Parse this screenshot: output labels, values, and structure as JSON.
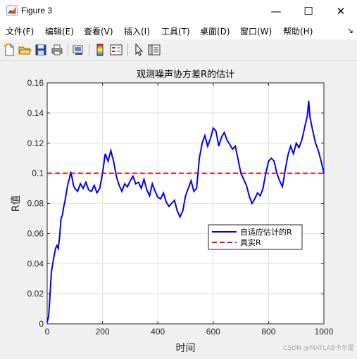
{
  "window": {
    "title": "Figure 3",
    "minimize": "—",
    "maximize": "☐",
    "close": "✕"
  },
  "menu": {
    "items": [
      "文件(F)",
      "编辑(E)",
      "查看(V)",
      "插入(I)",
      "工具(T)",
      "桌面(D)",
      "窗口(W)",
      "帮助(H)"
    ],
    "overflow": "↘"
  },
  "toolbar": {
    "icons": [
      "new-figure-icon",
      "open-file-icon",
      "save-icon",
      "print-icon",
      "link-plot-icon",
      "colorbar-icon",
      "legend-icon",
      "pointer-icon",
      "property-editor-icon"
    ]
  },
  "watermark": "CSDN @MATLAB卡尔曼",
  "colors": {
    "estimate": "#0000ff",
    "truth": "#ff0000",
    "grid": "#dfdfdf"
  },
  "chart_data": {
    "type": "line",
    "title": "观测噪声协方差R的估计",
    "xlabel": "时间",
    "ylabel": "R值",
    "xlim": [
      0,
      1000
    ],
    "ylim": [
      0,
      0.16
    ],
    "xticks": [
      0,
      200,
      400,
      600,
      800,
      1000
    ],
    "yticks": [
      0,
      0.02,
      0.04,
      0.06,
      0.08,
      0.1,
      0.12,
      0.14,
      0.16
    ],
    "xtick_labels": [
      "0",
      "200",
      "400",
      "600",
      "800",
      "1000"
    ],
    "ytick_labels": [
      "0",
      "0.02",
      "0.04",
      "0.06",
      "0.08",
      "0.1",
      "0.12",
      "0.14",
      "0.16"
    ],
    "grid": true,
    "legend_position": "lower-right",
    "series": [
      {
        "name": "自适应估计的R",
        "style": "solid",
        "x": [
          0,
          5,
          10,
          15,
          20,
          25,
          30,
          35,
          40,
          45,
          50,
          55,
          60,
          65,
          70,
          75,
          80,
          85,
          90,
          95,
          100,
          110,
          120,
          130,
          140,
          150,
          160,
          170,
          180,
          190,
          200,
          210,
          220,
          230,
          240,
          250,
          260,
          270,
          280,
          290,
          300,
          310,
          320,
          330,
          340,
          350,
          360,
          370,
          380,
          390,
          400,
          410,
          420,
          430,
          440,
          450,
          460,
          470,
          480,
          490,
          500,
          510,
          520,
          530,
          540,
          550,
          560,
          570,
          580,
          590,
          600,
          610,
          620,
          630,
          640,
          650,
          660,
          670,
          680,
          690,
          700,
          710,
          720,
          730,
          740,
          750,
          760,
          770,
          780,
          790,
          800,
          810,
          820,
          830,
          840,
          850,
          860,
          870,
          880,
          890,
          900,
          910,
          920,
          930,
          940,
          945,
          950,
          960,
          970,
          980,
          990,
          1000
        ],
        "y": [
          0.001,
          0.005,
          0.018,
          0.034,
          0.04,
          0.045,
          0.05,
          0.052,
          0.05,
          0.058,
          0.07,
          0.072,
          0.078,
          0.082,
          0.088,
          0.093,
          0.096,
          0.101,
          0.097,
          0.092,
          0.09,
          0.088,
          0.093,
          0.09,
          0.094,
          0.089,
          0.088,
          0.092,
          0.087,
          0.09,
          0.1,
          0.113,
          0.108,
          0.115,
          0.108,
          0.098,
          0.092,
          0.088,
          0.093,
          0.091,
          0.095,
          0.098,
          0.093,
          0.094,
          0.09,
          0.096,
          0.089,
          0.085,
          0.093,
          0.088,
          0.084,
          0.083,
          0.087,
          0.081,
          0.078,
          0.08,
          0.082,
          0.075,
          0.071,
          0.075,
          0.085,
          0.09,
          0.095,
          0.088,
          0.09,
          0.11,
          0.12,
          0.125,
          0.118,
          0.123,
          0.13,
          0.128,
          0.118,
          0.124,
          0.127,
          0.122,
          0.119,
          0.116,
          0.118,
          0.109,
          0.1,
          0.096,
          0.092,
          0.085,
          0.08,
          0.083,
          0.087,
          0.085,
          0.09,
          0.1,
          0.108,
          0.11,
          0.108,
          0.1,
          0.095,
          0.091,
          0.102,
          0.112,
          0.118,
          0.113,
          0.12,
          0.117,
          0.122,
          0.13,
          0.138,
          0.148,
          0.137,
          0.128,
          0.12,
          0.115,
          0.108,
          0.1
        ]
      },
      {
        "name": "真实R",
        "style": "dashed",
        "x": [
          0,
          1000
        ],
        "y": [
          0.1,
          0.1
        ]
      }
    ]
  }
}
